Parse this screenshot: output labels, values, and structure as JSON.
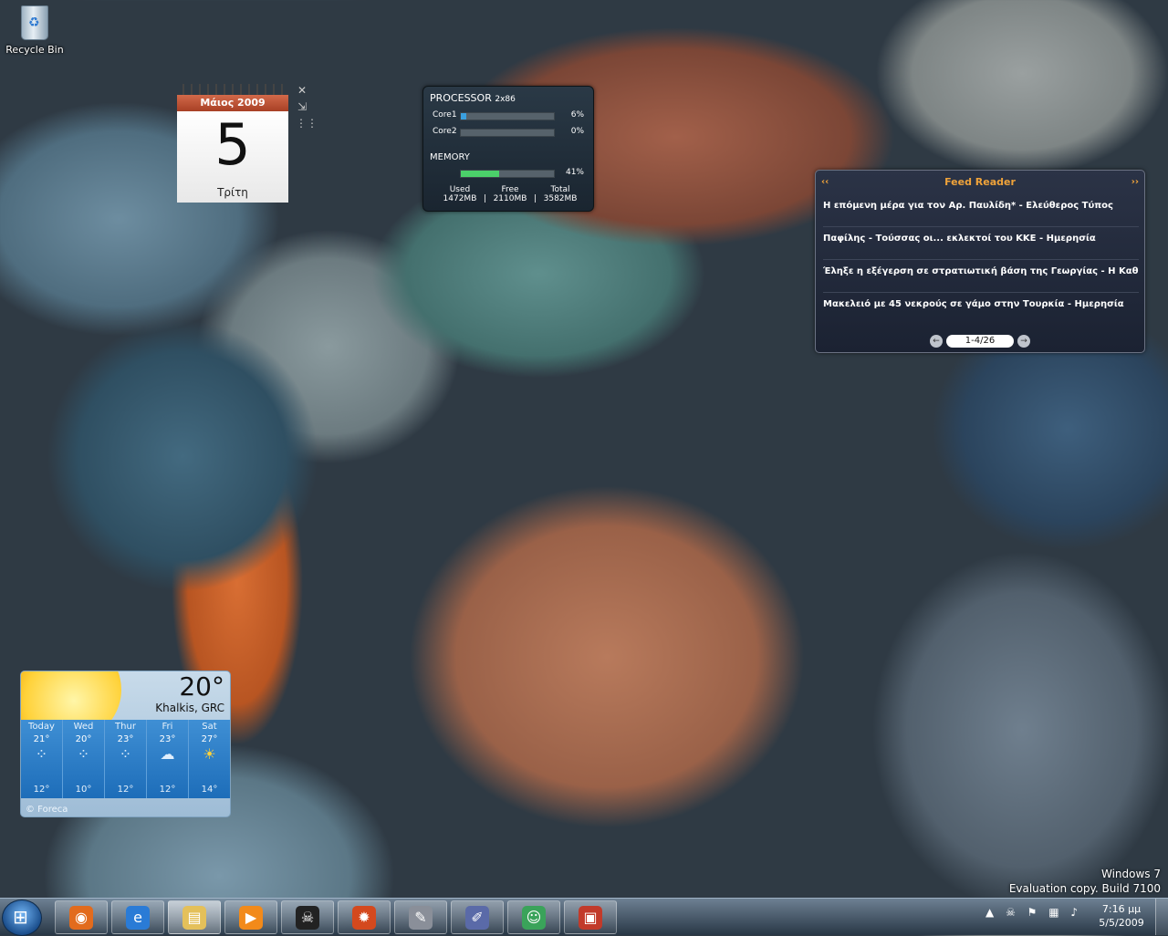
{
  "desktop": {
    "recycle_bin_label": "Recycle Bin"
  },
  "calendar": {
    "month_year": "Μάιος 2009",
    "day": "5",
    "weekday": "Τρίτη"
  },
  "gadget_controls": {
    "close_glyph": "✕",
    "options_glyph": "⇲",
    "drag_glyph": "⋮⋮"
  },
  "cpu": {
    "title": "PROCESSOR",
    "arch": "2x86",
    "cores": [
      {
        "name": "Core1",
        "percent": "6%",
        "value": 6
      },
      {
        "name": "Core2",
        "percent": "0%",
        "value": 0
      }
    ],
    "memory_title": "MEMORY",
    "memory_percent": "41%",
    "memory_value": 41,
    "stats": [
      {
        "label": "Used",
        "value": "1472MB"
      },
      {
        "label": "Free",
        "value": "2110MB"
      },
      {
        "label": "Total",
        "value": "3582MB"
      }
    ],
    "stat_separator": "|",
    "colors": {
      "core_fill": "#3aa0e0",
      "memory_fill": "#4bd06a"
    }
  },
  "feed": {
    "title": "Feed Reader",
    "prev_nav": "‹‹",
    "next_nav": "››",
    "items": [
      "Η επόμενη μέρα για τον Αρ. Παυλίδη* - Ελεύθερος Τύπος",
      "Παφίλης - Τούσσας οι... εκλεκτοί του ΚΚΕ - Ημερησία",
      "Έληξε η εξέγερση σε στρατιωτική βάση της Γεωργίας - Η Καθημε",
      "Μακελειό με 45 νεκρούς σε γάμο στην Τουρκία - Ημερησία"
    ],
    "page_indicator": "1-4/26",
    "prev_glyph": "←",
    "next_glyph": "→"
  },
  "weather": {
    "current_temp": "20°",
    "location": "Khalkis, GRC",
    "days": [
      {
        "name": "Today",
        "high": "21°",
        "low": "12°",
        "icon": "rain-icon",
        "glyph": "⁘"
      },
      {
        "name": "Wed",
        "high": "20°",
        "low": "10°",
        "icon": "rain-icon",
        "glyph": "⁘"
      },
      {
        "name": "Thur",
        "high": "23°",
        "low": "12°",
        "icon": "rain-icon",
        "glyph": "⁘"
      },
      {
        "name": "Fri",
        "high": "23°",
        "low": "12°",
        "icon": "cloud-icon",
        "glyph": "☁"
      },
      {
        "name": "Sat",
        "high": "27°",
        "low": "14°",
        "icon": "sun-icon",
        "glyph": "☀"
      }
    ],
    "credit": "© Foreca"
  },
  "watermark": {
    "line1": "Windows 7",
    "line2": "Evaluation copy. Build 7100"
  },
  "taskbar": {
    "buttons": [
      {
        "name": "firefox",
        "glyph": "◉",
        "color": "#e26b1d"
      },
      {
        "name": "internet-explorer",
        "glyph": "e",
        "color": "#2a7bd6"
      },
      {
        "name": "windows-explorer",
        "glyph": "▤",
        "color": "#e4c05a",
        "active": true
      },
      {
        "name": "media-player",
        "glyph": "▶",
        "color": "#f28a1a"
      },
      {
        "name": "alien-app",
        "glyph": "☠",
        "color": "#222222"
      },
      {
        "name": "burning-app",
        "glyph": "✹",
        "color": "#d4491e"
      },
      {
        "name": "tool-app",
        "glyph": "✎",
        "color": "#8a8f99"
      },
      {
        "name": "editor-app",
        "glyph": "✐",
        "color": "#5a6aa8"
      },
      {
        "name": "messenger",
        "glyph": "☺",
        "color": "#3aa35a"
      },
      {
        "name": "office-app",
        "glyph": "▣",
        "color": "#c23a2a"
      }
    ],
    "tray": {
      "arrow": "▲",
      "icons": [
        "☠",
        "⚑",
        "▦",
        "♪"
      ]
    },
    "clock": {
      "time": "7:16 μμ",
      "date": "5/5/2009"
    }
  }
}
